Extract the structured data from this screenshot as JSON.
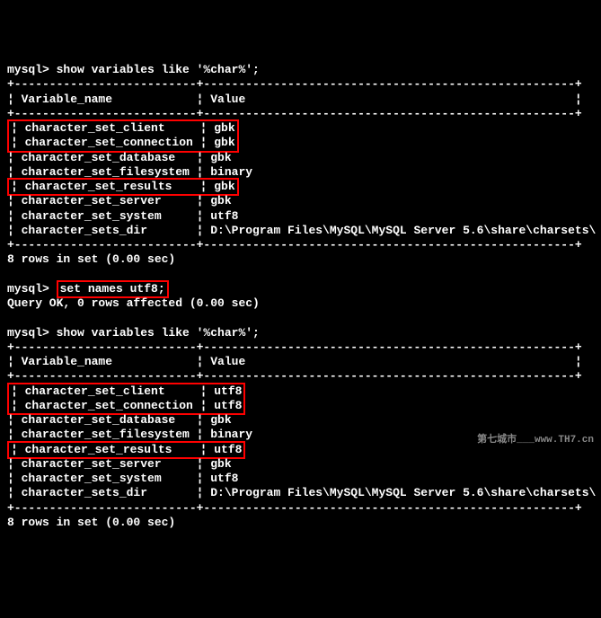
{
  "prompt": "mysql>",
  "cmd1": "show variables like '%char%';",
  "cmd2": "set names utf8;",
  "cmd3": "show variables like '%char%';",
  "header_var": "Variable_name",
  "header_val": "Value",
  "result1_msg": "8 rows in set (0.00 sec)",
  "query_ok": "Query OK, 0 rows affected (0.00 sec)",
  "sep_top": "+--------------------------+-----------------------------------------------------+",
  "sep_header": "¦ Variable_name            ¦ Value                                               ¦",
  "sep_mid": "+--------------------------+-----------------------------------------------------+",
  "table1": {
    "rows": [
      {
        "var": "character_set_client",
        "val": "gbk",
        "hl": "group1"
      },
      {
        "var": "character_set_connection",
        "val": "gbk",
        "hl": "group1"
      },
      {
        "var": "character_set_database",
        "val": "gbk",
        "hl": false
      },
      {
        "var": "character_set_filesystem",
        "val": "binary",
        "hl": false
      },
      {
        "var": "character_set_results",
        "val": "gbk",
        "hl": "single"
      },
      {
        "var": "character_set_server",
        "val": "gbk",
        "hl": false
      },
      {
        "var": "character_set_system",
        "val": "utf8",
        "hl": false
      },
      {
        "var": "character_sets_dir",
        "val": "D:\\Program Files\\MySQL\\MySQL Server 5.6\\share\\charsets\\",
        "hl": false
      }
    ]
  },
  "table2": {
    "rows": [
      {
        "var": "character_set_client",
        "val": "utf8",
        "hl": "group1"
      },
      {
        "var": "character_set_connection",
        "val": "utf8",
        "hl": "group1"
      },
      {
        "var": "character_set_database",
        "val": "gbk",
        "hl": false
      },
      {
        "var": "character_set_filesystem",
        "val": "binary",
        "hl": false
      },
      {
        "var": "character_set_results",
        "val": "utf8",
        "hl": "single"
      },
      {
        "var": "character_set_server",
        "val": "gbk",
        "hl": false
      },
      {
        "var": "character_set_system",
        "val": "utf8",
        "hl": false
      },
      {
        "var": "character_sets_dir",
        "val": "D:\\Program Files\\MySQL\\MySQL Server 5.6\\share\\charsets\\",
        "hl": false
      }
    ]
  },
  "watermark": "第七城市___www.TH7.cn"
}
